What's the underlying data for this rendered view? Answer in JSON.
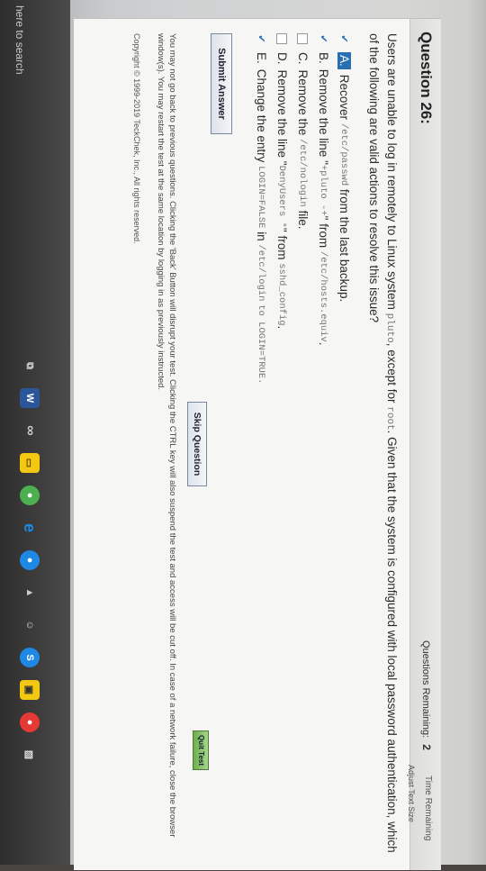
{
  "header": {
    "question_title": "Question 26:",
    "questions_remaining_label": "Questions Remaining:",
    "questions_remaining_value": "2",
    "time_remaining_label": "Time Remaining",
    "adjust_label": "Adjust Text Size"
  },
  "question": {
    "stem_part1": "Users are unable to log in remotely to Linux system",
    "stem_code1": "pluto",
    "stem_part2": ", except for",
    "stem_code2": "root",
    "stem_part3": ". Given that the system is configured with local password authentication, which of the following are valid actions to resolve this issue?",
    "options": [
      {
        "letter": "A.",
        "checked": true,
        "text_a": "Recover",
        "code_a": "/etc/passwd",
        "text_b": "from the last backup.",
        "code_b": "",
        "text_c": ""
      },
      {
        "letter": "B.",
        "checked": true,
        "text_a": "Remove the line \"",
        "code_a": "+pluto -+",
        "text_b": "\" from",
        "code_b": "/etc/hosts.equiv",
        "text_c": "."
      },
      {
        "letter": "C.",
        "checked": false,
        "text_a": "Remove the",
        "code_a": "/etc/nologin",
        "text_b": "file.",
        "code_b": "",
        "text_c": ""
      },
      {
        "letter": "D.",
        "checked": false,
        "text_a": "Remove the line \"",
        "code_a": "DenyUsers *",
        "text_b": "\" from",
        "code_b": "sshd_config",
        "text_c": "."
      },
      {
        "letter": "E.",
        "checked": true,
        "text_a": "Change the entry",
        "code_a": "LOGIN=FALSE",
        "text_b": "in",
        "code_b": "/etc/login",
        "text_c": "to LOGIN=TRUE."
      }
    ]
  },
  "buttons": {
    "submit": "Submit Answer",
    "skip": "Skip Question",
    "quit": "Quit Test"
  },
  "notice": "You may not go back to previous questions. Clicking the 'Back' Button will disrupt your test. Clicking the CTRL key will also suspend the test and access will be cut off. In case of a network failure, close the browser window(s). You may restart the test at the same location by logging in as previously instructed.",
  "copyright": "Copyright © 1999-2019 TeckChek, Inc., All rights reserved.",
  "taskbar": {
    "search_text": "here to search",
    "icons": [
      "task-view-icon",
      "word-icon",
      "infinity-icon",
      "file-explorer-icon",
      "chrome-icon",
      "edge-icon",
      "media-icon",
      "image-icon",
      "people-icon",
      "skype-icon",
      "store-icon",
      "chrome2-icon",
      "photos-icon"
    ],
    "accent_colors": [
      "#2b579a",
      "#f2c811",
      "#4caf50",
      "#1e88e5",
      "#e53935"
    ]
  }
}
